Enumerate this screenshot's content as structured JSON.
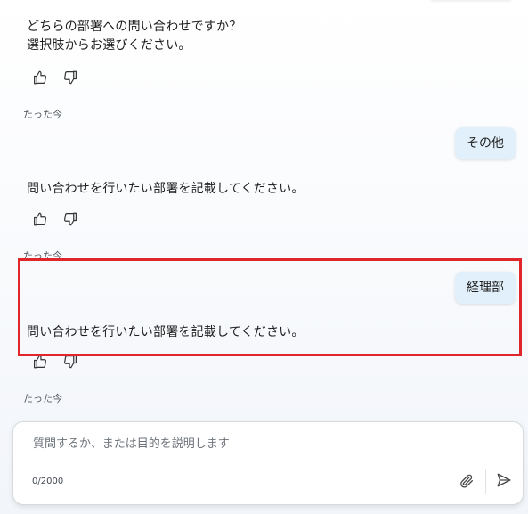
{
  "messages": {
    "bot_1_line1": "どちらの部署への問い合わせですか？",
    "bot_1_line2": "選択肢からお選びください。",
    "time_1": "たった今",
    "user_1": "その他",
    "bot_2": "問い合わせを行いたい部署を記載してください。",
    "time_2": "たった今",
    "user_2": "経理部",
    "bot_3": "問い合わせを行いたい部署を記載してください。",
    "time_3": "たった今"
  },
  "composer": {
    "placeholder": "質問するか、または目的を説明します",
    "value": "",
    "char_count": "0/2000"
  },
  "icons": {
    "thumbs_up": "thumbs-up-icon",
    "thumbs_down": "thumbs-down-icon",
    "attach": "paperclip-icon",
    "send": "send-icon"
  },
  "colors": {
    "user_bubble": "#e1f0fa",
    "highlight_border": "#e0262b",
    "icon_stroke": "#333333"
  }
}
